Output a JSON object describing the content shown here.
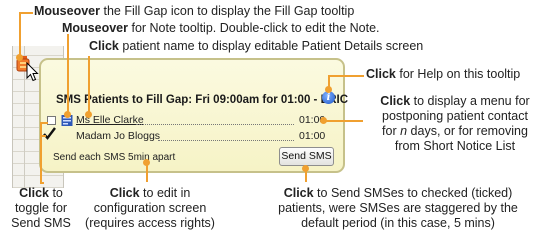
{
  "tooltip": {
    "title": "SMS Patients to Fill Gap: Fri 09:00am for 01:00 - ERIC",
    "patients": [
      {
        "name": "Ms Elle Clarke",
        "duration": "01:00",
        "checked": false
      },
      {
        "name": "Madam Jo Bloggs",
        "duration": "01:00",
        "checked": true
      }
    ],
    "footer_text": "Send each SMS 5min apart",
    "send_button_label": "Send SMS",
    "help_icon_glyph": "i"
  },
  "callouts": {
    "fill_gap": {
      "lead": "Mouseover",
      "rest": " the Fill Gap icon to display the Fill Gap tooltip"
    },
    "note": {
      "lead": "Mouseover",
      "rest": " for Note tooltip. Double-click to edit the Note."
    },
    "patient_name": {
      "lead": "Click",
      "rest": " patient name to display editable Patient Details screen"
    },
    "help": {
      "lead": "Click",
      "rest": " for Help on this tooltip"
    },
    "duration_line1": {
      "lead": "Click",
      "rest": " to display a menu for"
    },
    "duration_line2": "postponing patient contact",
    "duration_line3_pre": "for ",
    "duration_line3_n": "n",
    "duration_line3_post": " days, or for removing",
    "duration_line4": "from Short Notice List",
    "toggle_line1": {
      "lead": "Click",
      "rest": " to"
    },
    "toggle_line2": "toggle for",
    "toggle_line3": "Send SMS",
    "config_line1": {
      "lead": "Click",
      "rest": " to edit in"
    },
    "config_line2": "configuration screen",
    "config_line3": "(requires access rights)",
    "send_line1": {
      "lead": "Click",
      "rest": " to Send SMSes to checked (ticked)"
    },
    "send_line2": "patients, were SMSes are staggered by the",
    "send_line3": "default period (in this case, 5 mins)"
  },
  "colors": {
    "accent": "#f0a030",
    "tooltip_bg": "#f8f6d0",
    "tooltip_border": "#c6c18a"
  },
  "icons": [
    "fill-gap-icon",
    "mouse-cursor-icon",
    "note-icon",
    "help-icon",
    "checkmark-icon"
  ]
}
